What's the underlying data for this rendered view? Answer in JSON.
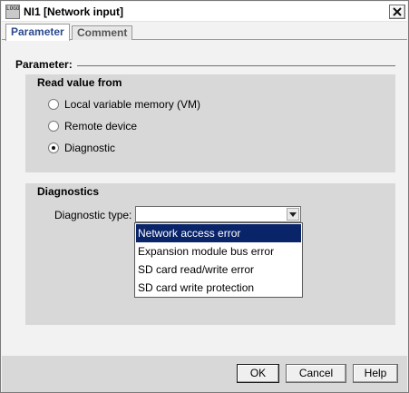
{
  "window": {
    "title": "NI1 [Network input]",
    "app_icon_text": "LOGO"
  },
  "tabs": [
    {
      "label": "Parameter",
      "active": true
    },
    {
      "label": "Comment",
      "active": false
    }
  ],
  "parameter_section": {
    "heading": "Parameter:"
  },
  "read_value_group": {
    "title": "Read value from",
    "options": [
      {
        "label": "Local variable memory (VM)",
        "checked": false
      },
      {
        "label": "Remote device",
        "checked": false
      },
      {
        "label": "Diagnostic",
        "checked": true
      }
    ]
  },
  "diagnostics_group": {
    "title": "Diagnostics",
    "type_label": "Diagnostic type:",
    "combo_value": "",
    "dropdown_options": [
      {
        "label": "Network access error",
        "highlighted": true
      },
      {
        "label": "Expansion module bus error",
        "highlighted": false
      },
      {
        "label": "SD card read/write error",
        "highlighted": false
      },
      {
        "label": "SD card write protection",
        "highlighted": false
      }
    ]
  },
  "buttons": {
    "ok": "OK",
    "cancel": "Cancel",
    "help": "Help"
  },
  "icons": {
    "close": "close-icon",
    "combo_arrow": "chevron-down-icon"
  },
  "colors": {
    "selection": "#0a246a",
    "active_tab_text": "#2b4a8f",
    "group_background": "#d8d8d8"
  }
}
